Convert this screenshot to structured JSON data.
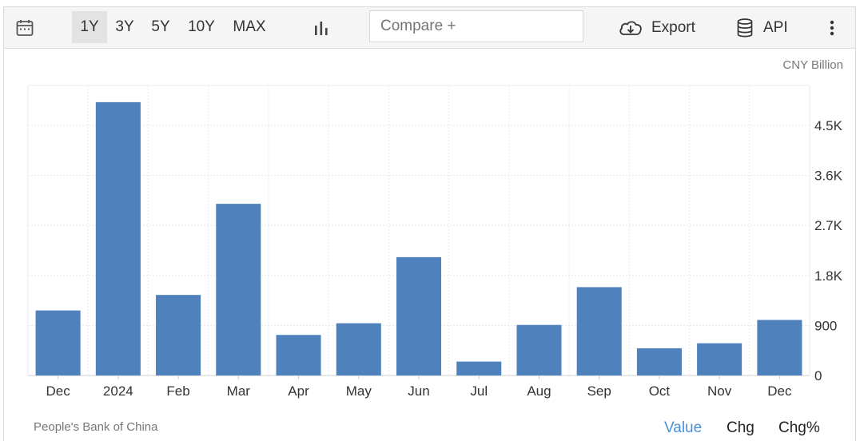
{
  "toolbar": {
    "calendar_icon": "calendar-icon",
    "ranges": [
      {
        "label": "1Y",
        "active": true
      },
      {
        "label": "3Y",
        "active": false
      },
      {
        "label": "5Y",
        "active": false
      },
      {
        "label": "10Y",
        "active": false
      },
      {
        "label": "MAX",
        "active": false
      }
    ],
    "chart_type_icon": "bar-chart-icon",
    "compare_placeholder": "Compare +",
    "export_label": "Export",
    "api_label": "API",
    "more_icon": "vertical-dots-icon"
  },
  "unit_label": "CNY Billion",
  "source": "People's Bank of China",
  "tabs": [
    {
      "label": "Value",
      "active": true
    },
    {
      "label": "Chg",
      "active": false
    },
    {
      "label": "Chg%",
      "active": false
    }
  ],
  "colors": {
    "bar": "#4f81bd",
    "active_tab": "#4a8fd6",
    "grid": "#e6e6e6"
  },
  "chart_data": {
    "type": "bar",
    "title": "",
    "xlabel": "",
    "ylabel": "",
    "categories": [
      "Dec",
      "2024",
      "Feb",
      "Mar",
      "Apr",
      "May",
      "Jun",
      "Jul",
      "Aug",
      "Sep",
      "Oct",
      "Nov",
      "Dec"
    ],
    "values": [
      1170,
      4920,
      1450,
      3090,
      730,
      940,
      2130,
      250,
      910,
      1590,
      490,
      580,
      1000
    ],
    "ylim": [
      0,
      5220
    ],
    "yticks": [
      0,
      900,
      1800,
      2700,
      3600,
      4500
    ],
    "ytick_labels": [
      "0",
      "900",
      "1.8K",
      "2.7K",
      "3.6K",
      "4.5K"
    ],
    "grid": true,
    "y_axis_position": "right"
  }
}
